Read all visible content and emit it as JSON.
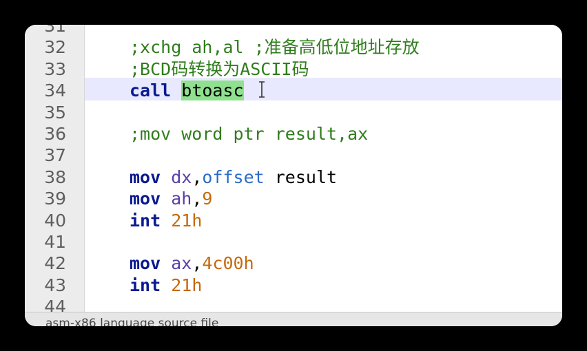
{
  "editor": {
    "lines": [
      {
        "num": "31",
        "tokens": []
      },
      {
        "num": "32",
        "tokens": [
          {
            "t": ";xchg ah,al ;准备高低位地址存放",
            "c": "cmt"
          }
        ]
      },
      {
        "num": "33",
        "tokens": [
          {
            "t": ";BCD码转换为ASCII码",
            "c": "cmt"
          }
        ]
      },
      {
        "num": "34",
        "tokens": [
          {
            "t": "call",
            "c": "kw"
          },
          {
            "t": " ",
            "c": ""
          },
          {
            "t": "btoasc",
            "c": "hl"
          }
        ]
      },
      {
        "num": "35",
        "tokens": []
      },
      {
        "num": "36",
        "tokens": [
          {
            "t": ";mov word ptr result,ax",
            "c": "cmt"
          }
        ]
      },
      {
        "num": "37",
        "tokens": []
      },
      {
        "num": "38",
        "tokens": [
          {
            "t": "mov",
            "c": "kw"
          },
          {
            "t": " ",
            "c": ""
          },
          {
            "t": "dx",
            "c": "reg"
          },
          {
            "t": ",",
            "c": ""
          },
          {
            "t": "offset",
            "c": "dir"
          },
          {
            "t": " result",
            "c": ""
          }
        ]
      },
      {
        "num": "39",
        "tokens": [
          {
            "t": "mov",
            "c": "kw"
          },
          {
            "t": " ",
            "c": ""
          },
          {
            "t": "ah",
            "c": "reg"
          },
          {
            "t": ",",
            "c": ""
          },
          {
            "t": "9",
            "c": "num"
          }
        ]
      },
      {
        "num": "40",
        "tokens": [
          {
            "t": "int",
            "c": "kw"
          },
          {
            "t": " ",
            "c": ""
          },
          {
            "t": "21h",
            "c": "num"
          }
        ]
      },
      {
        "num": "41",
        "tokens": []
      },
      {
        "num": "42",
        "tokens": [
          {
            "t": "mov",
            "c": "kw"
          },
          {
            "t": " ",
            "c": ""
          },
          {
            "t": "ax",
            "c": "reg"
          },
          {
            "t": ",",
            "c": ""
          },
          {
            "t": "4c00h",
            "c": "num"
          }
        ]
      },
      {
        "num": "43",
        "tokens": [
          {
            "t": "int",
            "c": "kw"
          },
          {
            "t": " ",
            "c": ""
          },
          {
            "t": "21h",
            "c": "num"
          }
        ]
      },
      {
        "num": "44",
        "tokens": []
      }
    ],
    "current_line": "34"
  },
  "statusbar": {
    "text": "asm-x86 language source file"
  },
  "colors": {
    "keyword": "#0b1a8f",
    "register": "#5a3ea8",
    "number": "#c56a0c",
    "directive": "#2a6bc8",
    "comment": "#2f7d1c",
    "highlight": "#8fe08f",
    "current_line_bg": "#e8e8ff"
  },
  "icons": {
    "cursor": "text-cursor-icon"
  }
}
